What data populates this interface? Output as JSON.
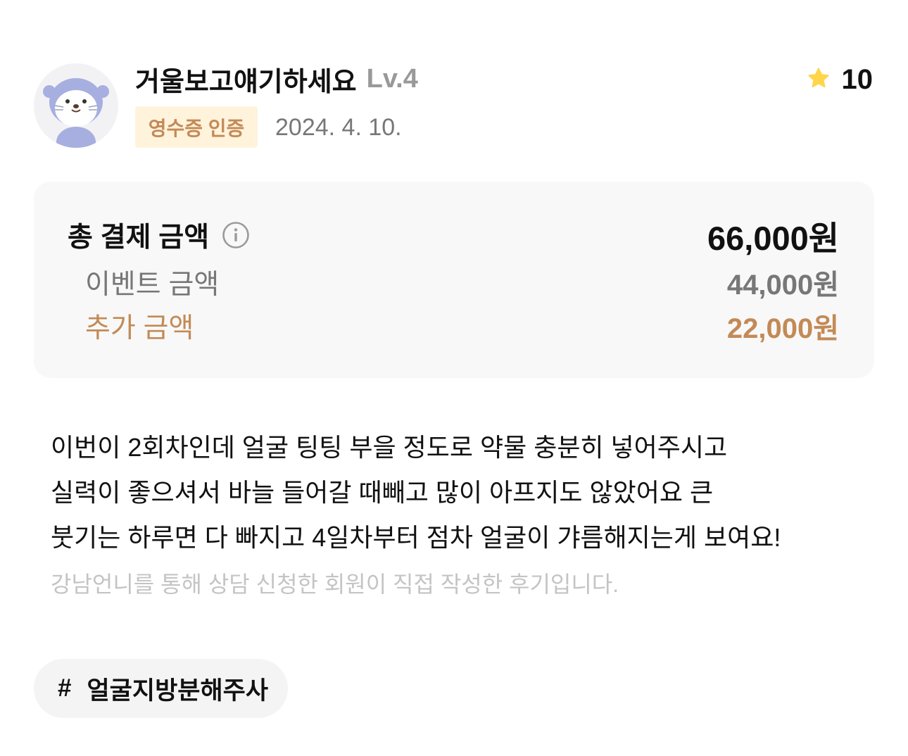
{
  "review": {
    "user": {
      "name": "거울보고얘기하세요",
      "level": "Lv.4",
      "avatar_icon": "otter-avatar-icon"
    },
    "badge": "영수증 인증",
    "date": "2024. 4. 10.",
    "rating": {
      "icon": "star-icon",
      "value": "10",
      "star_color": "#ffd54a"
    },
    "price": {
      "total_label": "총 결제 금액",
      "total_value": "66,000원",
      "event_label": "이벤트 금액",
      "event_value": "44,000원",
      "extra_label": "추가 금액",
      "extra_value": "22,000원",
      "info_icon": "info-icon",
      "accent_color": "#c38a56"
    },
    "body_lines": [
      "이번이 2회차인데 얼굴 팅팅 부을 정도로 약물 충분히 넣어주시고",
      "실력이 좋으셔서 바늘 들어갈 때빼고 많이 아프지도 않았어요 큰",
      "붓기는 하루면 다 빠지고 4일차부터 점차 얼굴이 갸름해지는게 보여요!"
    ],
    "disclaimer": "강남언니를 통해 상담 신청한 회원이 직접 작성한 후기입니다.",
    "tag": {
      "symbol": "#",
      "label": "얼굴지방분해주사"
    }
  }
}
